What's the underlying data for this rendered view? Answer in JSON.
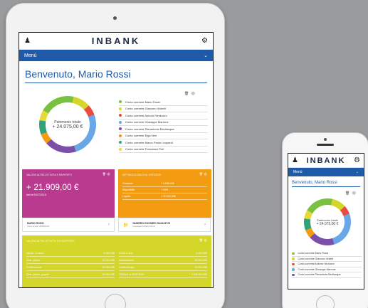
{
  "app": {
    "logo": "INBANK",
    "menu_label": "Menù",
    "welcome": "Benvenuto, Mario Rossi"
  },
  "donut": {
    "label": "Patrimonio totale",
    "value": "+ 24.075,00 €"
  },
  "accounts": [
    {
      "name": "Conto corrente Mario Rossi",
      "color": "#7ac142",
      "share": 0.2
    },
    {
      "name": "Conto corrente Giacomo Violetti",
      "color": "#d4d62a",
      "share": 0.1
    },
    {
      "name": "Conto corrente Antonio Verduzzo",
      "color": "#e84c3d",
      "share": 0.06
    },
    {
      "name": "Conto corrente Giuseppe Marrone",
      "color": "#6aa7e8",
      "share": 0.26
    },
    {
      "name": "Conto corrente Pierantonio Bevilacqua",
      "color": "#7b4fa8",
      "share": 0.18
    },
    {
      "name": "Conto corrente Elga Neri",
      "color": "#f39c12",
      "share": 0.06
    },
    {
      "name": "Conto corrente Marco Paolo Leopardi",
      "color": "#2ea37a",
      "share": 0.08
    },
    {
      "name": "Conto corrente Francesco Poli",
      "color": "#e8d93a",
      "share": 0.06
    }
  ],
  "mobile_accounts_shown": 5,
  "card_magenta": {
    "caption": "Valore altre attività e rapporti",
    "value": "+ 21.909,00 €",
    "date": "dati al 09/07/2015"
  },
  "card_orange": {
    "caption": "Dettaglio saldi al 10/07/2015",
    "rows": [
      {
        "label": "Contabile",
        "value": "+ 9.999,00€"
      },
      {
        "label": "Disponibile",
        "value": "+ 34%"
      },
      {
        "label": "Liquido",
        "value": "+ 20.000,00€"
      }
    ]
  },
  "info_left": {
    "title": "MARIO ROSSI",
    "sub": "Punti servizi 4658/0/2/5"
  },
  "info_right": {
    "title": "NUMERO DOSSIER 2041123729",
    "sub": "Intestatario Mario Rossi"
  },
  "card_yellow": {
    "caption": "Valore altre attività e/o rapporti",
    "left": [
      {
        "label": "Depos. conserv.",
        "value": "4.000,00€"
      },
      {
        "label": "Gest. patrim.",
        "value": "37.000,00€"
      },
      {
        "label": "Pronti termine",
        "value": "20.000,00€"
      },
      {
        "label": "Gest. patrim. proprie",
        "value": "30.000,00€"
      }
    ],
    "right": [
      {
        "label": "Fondi in sott.",
        "value": "4.000,00€"
      },
      {
        "label": "Assicurazioni",
        "value": "20.000,00€"
      },
      {
        "label": "Certificati dep.",
        "value": "20.000,00€"
      },
      {
        "label": "TOTALE al 09/07/2015",
        "value": "+ 1.900.000,00€"
      }
    ]
  },
  "icons": {
    "user": "user-icon",
    "settings": "gears-icon",
    "chevron": "chevron-down-icon"
  }
}
